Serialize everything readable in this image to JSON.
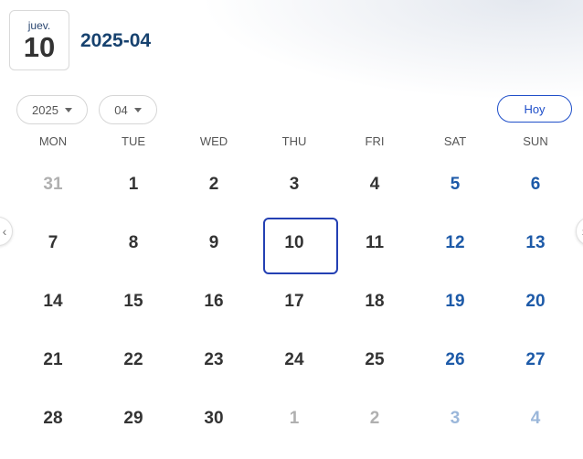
{
  "header": {
    "card_weekday": "juev.",
    "card_day": "10",
    "month_title": "2025-04"
  },
  "controls": {
    "year_select": "2025",
    "month_select": "04",
    "today_button": "Hoy"
  },
  "icons": {
    "prev": "chevron-left-icon",
    "next": "chevron-right-icon",
    "dropdown": "caret-down-icon"
  },
  "colors": {
    "title": "#17426f",
    "weekend": "#1d5aa8",
    "selected_border": "#2440b3",
    "today_button": "#1f4fc9"
  },
  "weekdays": [
    "MON",
    "TUE",
    "WED",
    "THU",
    "FRI",
    "SAT",
    "SUN"
  ],
  "weeks": [
    [
      "31",
      "1",
      "2",
      "3",
      "4",
      "5",
      "6"
    ],
    [
      "7",
      "8",
      "9",
      "10",
      "11",
      "12",
      "13"
    ],
    [
      "14",
      "15",
      "16",
      "17",
      "18",
      "19",
      "20"
    ],
    [
      "21",
      "22",
      "23",
      "24",
      "25",
      "26",
      "27"
    ],
    [
      "28",
      "29",
      "30",
      "1",
      "2",
      "3",
      "4"
    ]
  ],
  "selected_date": "10"
}
